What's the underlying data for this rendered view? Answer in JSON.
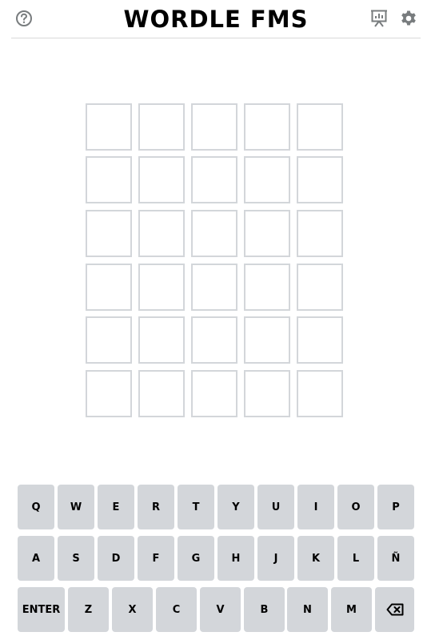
{
  "header": {
    "title": "WORDLE FMS",
    "icons": [
      "help-icon",
      "stats-icon",
      "settings-icon"
    ]
  },
  "board": {
    "rows": [
      [
        "",
        "",
        "",
        "",
        ""
      ],
      [
        "",
        "",
        "",
        "",
        ""
      ],
      [
        "",
        "",
        "",
        "",
        ""
      ],
      [
        "",
        "",
        "",
        "",
        ""
      ],
      [
        "",
        "",
        "",
        "",
        ""
      ],
      [
        "",
        "",
        "",
        "",
        ""
      ]
    ]
  },
  "keyboard": {
    "rows": [
      [
        "Q",
        "W",
        "E",
        "R",
        "T",
        "Y",
        "U",
        "I",
        "O",
        "P"
      ],
      [
        "A",
        "S",
        "D",
        "F",
        "G",
        "H",
        "J",
        "K",
        "L",
        "Ñ"
      ],
      [
        "ENTER",
        "Z",
        "X",
        "C",
        "V",
        "B",
        "N",
        "M",
        "⌫"
      ]
    ]
  },
  "colors": {
    "tile_border": "#d3d6da",
    "key_background": "#d3d6da",
    "icon": "#787c7e"
  }
}
